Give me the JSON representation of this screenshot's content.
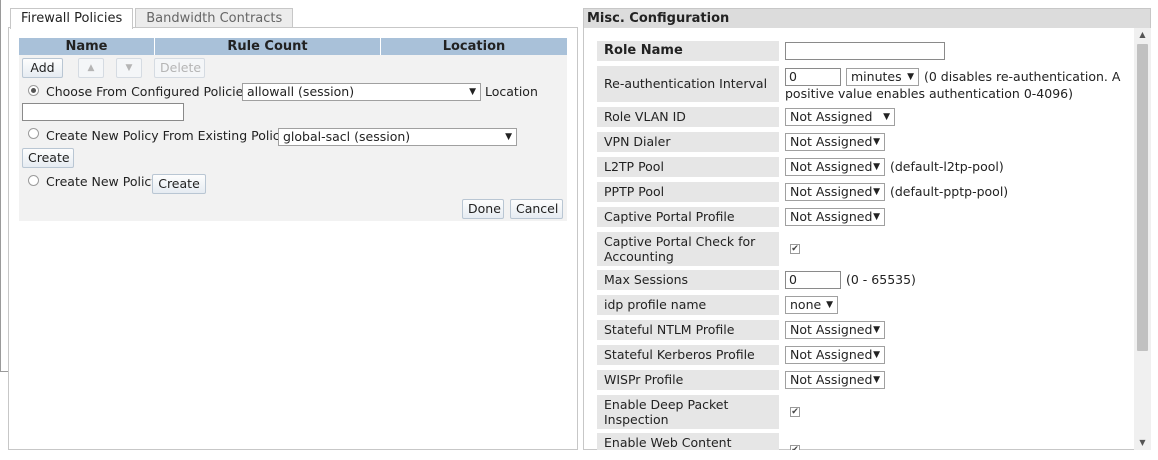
{
  "tabs": [
    {
      "label": "Firewall Policies"
    },
    {
      "label": "Bandwidth Contracts"
    }
  ],
  "policy_table": {
    "columns": [
      "Name",
      "Rule Count",
      "Location"
    ],
    "buttons": {
      "add": "Add",
      "up": "▲",
      "down": "▼",
      "delete": "Delete"
    }
  },
  "configured": {
    "label": "Choose From Configured Policies",
    "selected": "allowall (session)",
    "location_label": "Location",
    "location_value": ""
  },
  "existing": {
    "label": "Create New Policy From Existing Policy",
    "selected": "global-sacl (session)",
    "create_label": "Create"
  },
  "new_policy": {
    "label": "Create New Policy",
    "create_label": "Create"
  },
  "actions": {
    "done": "Done",
    "cancel": "Cancel"
  },
  "misc": {
    "title": "Misc. Configuration",
    "role_name": {
      "label": "Role Name",
      "value": ""
    },
    "reauth": {
      "label": "Re-authentication Interval",
      "value": "0",
      "unit": "minutes",
      "note_line1": "(0 disables re-authentication. A",
      "note_line2": "positive value enables authentication 0-4096)"
    },
    "role_vlan": {
      "label": "Role VLAN ID",
      "value": "Not Assigned"
    },
    "vpn_dialer": {
      "label": "VPN Dialer",
      "value": "Not Assigned"
    },
    "l2tp_pool": {
      "label": "L2TP Pool",
      "value": "Not Assigned",
      "note": "(default-l2tp-pool)"
    },
    "pptp_pool": {
      "label": "PPTP Pool",
      "value": "Not Assigned",
      "note": "(default-pptp-pool)"
    },
    "captive_profile": {
      "label": "Captive Portal Profile",
      "value": "Not Assigned"
    },
    "captive_check": {
      "label": "Captive Portal Check for Accounting",
      "checked": true
    },
    "max_sessions": {
      "label": "Max Sessions",
      "value": "0",
      "note": "(0 - 65535)"
    },
    "idp_profile": {
      "label": "idp profile name",
      "value": "none"
    },
    "ntlm": {
      "label": "Stateful NTLM Profile",
      "value": "Not Assigned"
    },
    "kerberos": {
      "label": "Stateful Kerberos Profile",
      "value": "Not Assigned"
    },
    "wispr": {
      "label": "WISPr Profile",
      "value": "Not Assigned"
    },
    "dpi": {
      "label": "Enable Deep Packet Inspection",
      "checked": true
    },
    "web_content": {
      "label": "Enable Web Content",
      "checked": true
    }
  },
  "icons": {
    "checkmark": "✔",
    "select_arrow": "▼",
    "scroll_up": "▲",
    "scroll_down": "▼"
  }
}
